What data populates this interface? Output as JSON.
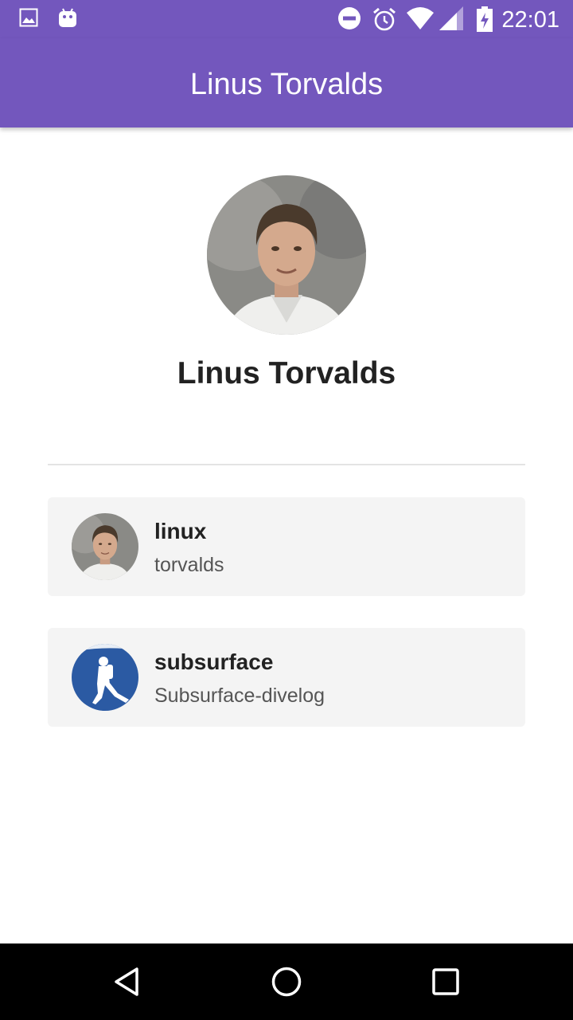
{
  "status_bar": {
    "time": "22:01",
    "left_icons": [
      "image-icon",
      "android-icon"
    ],
    "right_icons": [
      "do-not-disturb-icon",
      "alarm-icon",
      "wifi-icon",
      "signal-icon",
      "battery-charging-icon"
    ]
  },
  "app_bar": {
    "title": "Linus Torvalds"
  },
  "profile": {
    "name": "Linus Torvalds",
    "avatar": "profile-photo"
  },
  "repos": [
    {
      "name": "linux",
      "subtitle": "torvalds",
      "avatar": "user-photo-icon"
    },
    {
      "name": "subsurface",
      "subtitle": "Subsurface-divelog",
      "avatar": "diver-logo-icon"
    }
  ],
  "nav_bar": {
    "buttons": [
      "back-icon",
      "home-icon",
      "recents-icon"
    ]
  },
  "colors": {
    "primary": "#7357bd",
    "card_background": "#f4f4f4",
    "nav_background": "#000000"
  }
}
